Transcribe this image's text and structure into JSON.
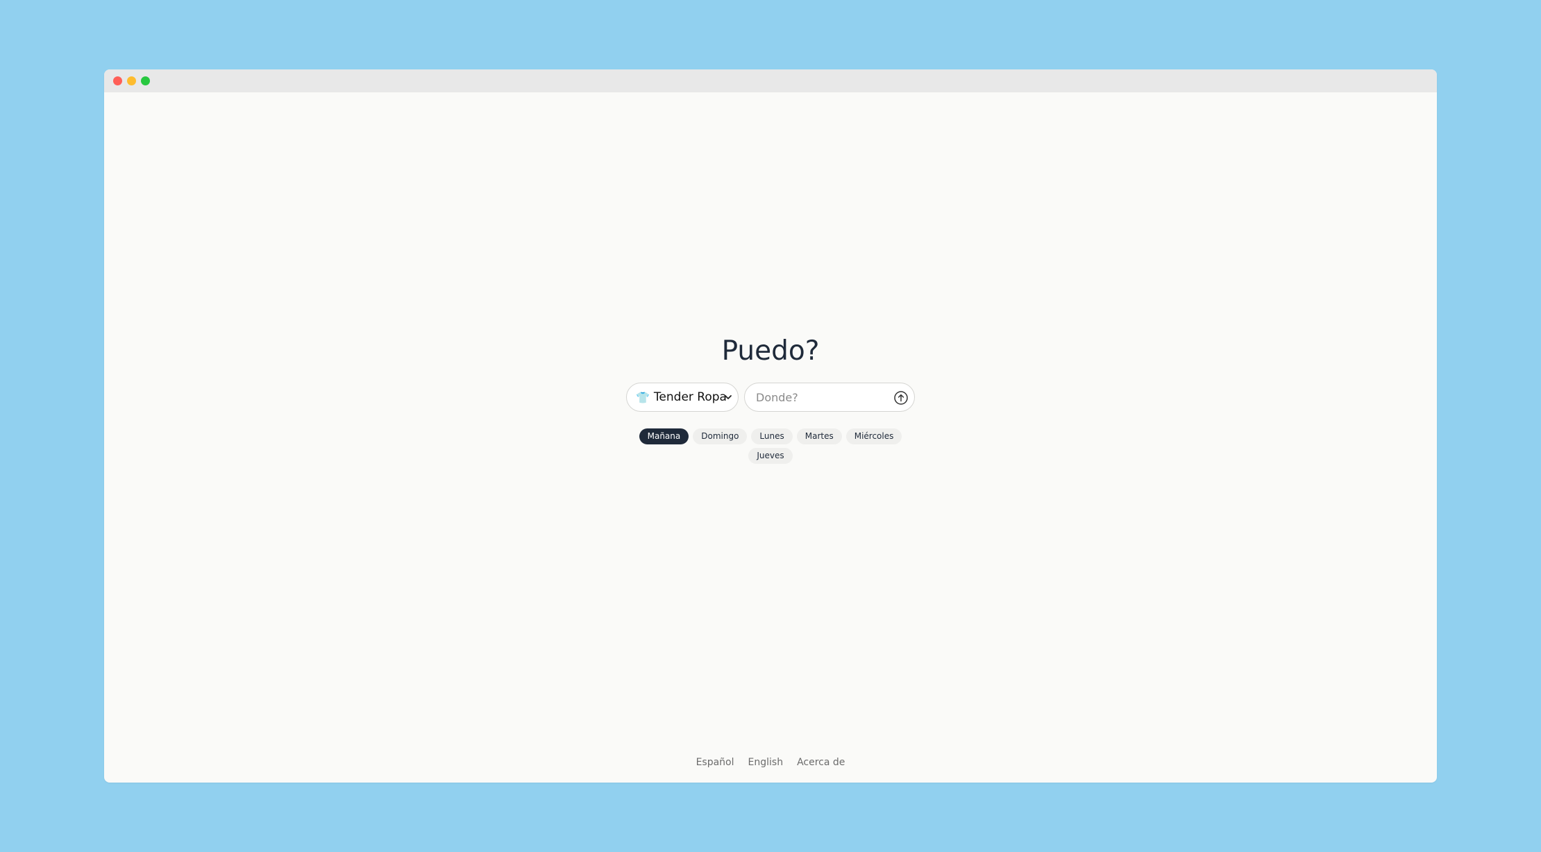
{
  "page": {
    "title": "Puedo?"
  },
  "activity": {
    "emoji": "👕",
    "selected_label": "Tender Ropa"
  },
  "location": {
    "placeholder": "Donde?",
    "value": ""
  },
  "days": [
    {
      "label": "Mañana",
      "active": true
    },
    {
      "label": "Domingo",
      "active": false
    },
    {
      "label": "Lunes",
      "active": false
    },
    {
      "label": "Martes",
      "active": false
    },
    {
      "label": "Miércoles",
      "active": false
    },
    {
      "label": "Jueves",
      "active": false
    }
  ],
  "footer": {
    "links": [
      "Español",
      "English",
      "Acerca de"
    ]
  },
  "colors": {
    "background": "#91d0ef",
    "accent_dark": "#1f2a3a",
    "chip": "#efefed"
  },
  "icons": {
    "submit": "arrow-up-circle-icon",
    "select": "chevron-down-icon"
  }
}
